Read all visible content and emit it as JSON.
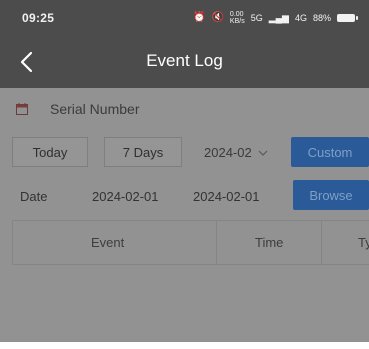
{
  "status_bar": {
    "time": "09:25",
    "network_speed": "0.00\nKB/s",
    "signal_1": "5G",
    "signal_2": "4G",
    "battery": "88%"
  },
  "nav": {
    "title": "Event Log"
  },
  "serial": {
    "label": "Serial Number"
  },
  "filters": {
    "today": "Today",
    "seven_days": "7 Days",
    "month_value": "2024-02",
    "custom": "Custom"
  },
  "date_range": {
    "label": "Date",
    "start": "2024-02-01",
    "end": "2024-02-01",
    "browse": "Browse"
  },
  "table": {
    "columns": [
      "Event",
      "Time",
      "Ty"
    ]
  },
  "colors": {
    "bar": "#4c4c4c",
    "content": "#929292",
    "accent": "#2a5a97"
  }
}
